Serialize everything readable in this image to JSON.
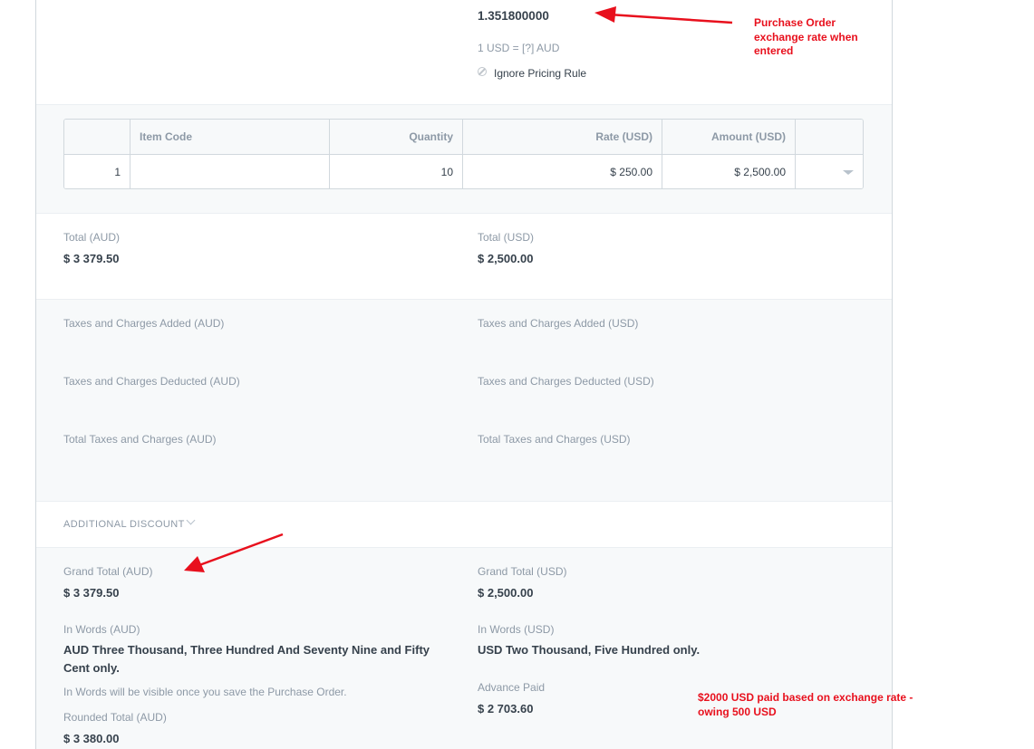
{
  "header": {
    "exchange_rate_value": "1.351800000",
    "exchange_rate_help": "1 USD = [?] AUD",
    "ignore_pricing_rule_label": "Ignore Pricing Rule"
  },
  "items_table": {
    "columns": [
      "",
      "Item Code",
      "Quantity",
      "Rate (USD)",
      "Amount (USD)",
      ""
    ],
    "rows": [
      {
        "idx": "1",
        "item_code": "",
        "quantity": "10",
        "rate": "$ 250.00",
        "amount": "$ 2,500.00"
      }
    ]
  },
  "totals": {
    "total_aud_label": "Total (AUD)",
    "total_aud_value": "$ 3 379.50",
    "total_usd_label": "Total (USD)",
    "total_usd_value": "$ 2,500.00"
  },
  "taxes": {
    "added_aud_label": "Taxes and Charges Added (AUD)",
    "added_usd_label": "Taxes and Charges Added (USD)",
    "deducted_aud_label": "Taxes and Charges Deducted (AUD)",
    "deducted_usd_label": "Taxes and Charges Deducted (USD)",
    "total_aud_label": "Total Taxes and Charges (AUD)",
    "total_usd_label": "Total Taxes and Charges (USD)"
  },
  "discount": {
    "section_label": "ADDITIONAL DISCOUNT"
  },
  "grand": {
    "grand_total_aud_label": "Grand Total (AUD)",
    "grand_total_aud_value": "$ 3 379.50",
    "grand_total_usd_label": "Grand Total (USD)",
    "grand_total_usd_value": "$ 2,500.00",
    "in_words_aud_label": "In Words (AUD)",
    "in_words_aud_value": "AUD Three Thousand, Three Hundred And Seventy Nine and Fifty Cent only.",
    "in_words_help": "In Words will be visible once you save the Purchase Order.",
    "in_words_usd_label": "In Words (USD)",
    "in_words_usd_value": "USD Two Thousand, Five Hundred only.",
    "rounded_total_aud_label": "Rounded Total (AUD)",
    "rounded_total_aud_value": "$ 3 380.00",
    "advance_paid_label": "Advance Paid",
    "advance_paid_value": "$ 2 703.60"
  },
  "annotations": {
    "note_exchange_rate": "Purchase Order exchange rate when entered",
    "note_advance": "$2000 USD paid based on exchange rate - owing 500 USD",
    "color": "#e8101d"
  }
}
